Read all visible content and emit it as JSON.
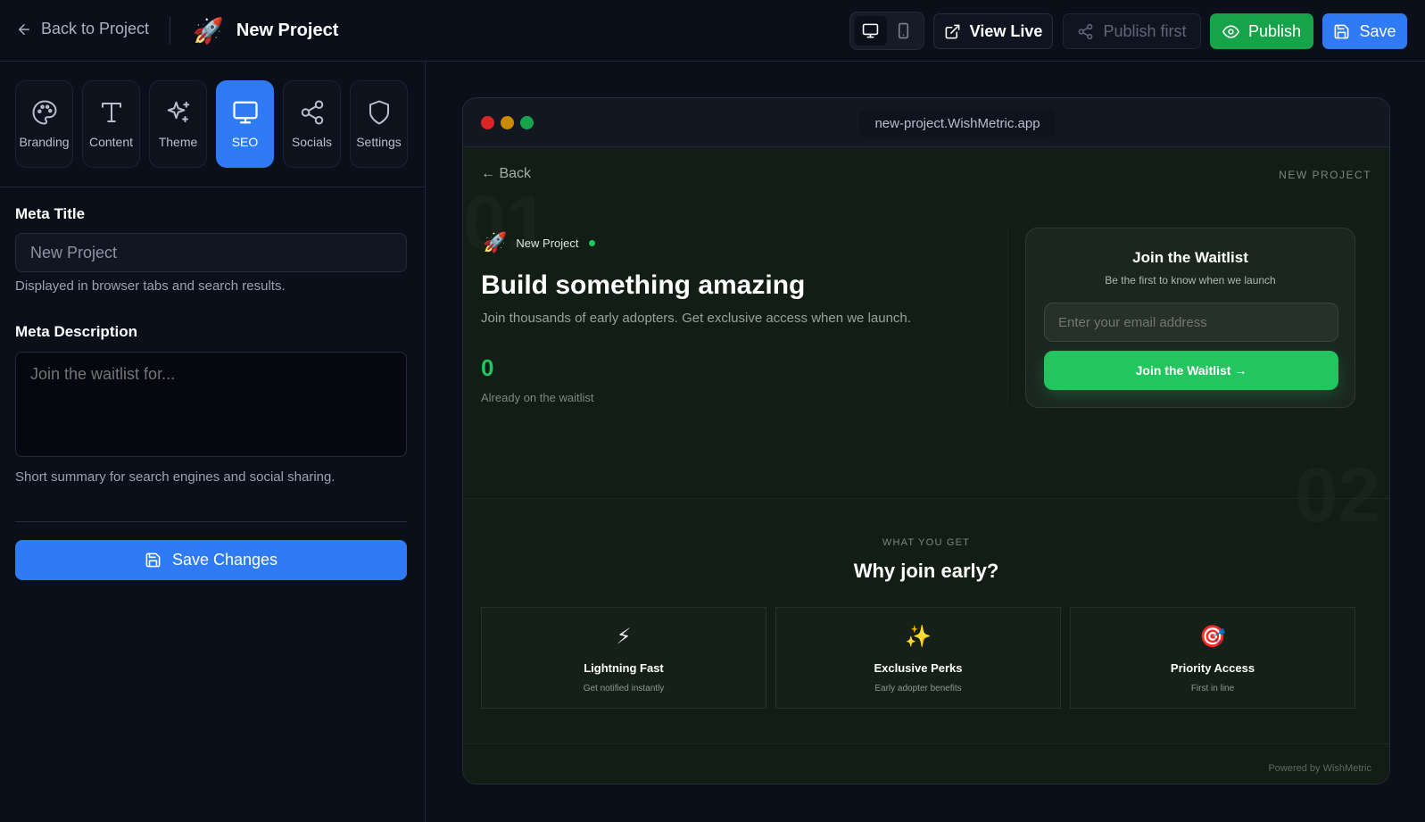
{
  "topbar": {
    "back_label": "Back to Project",
    "project_title": "New Project",
    "project_emoji": "🚀",
    "view_live": "View Live",
    "publish_first": "Publish first",
    "publish": "Publish",
    "save": "Save"
  },
  "sidebar": {
    "tabs": [
      {
        "label": "Branding",
        "icon": "palette-icon"
      },
      {
        "label": "Content",
        "icon": "type-icon"
      },
      {
        "label": "Theme",
        "icon": "sparkles-icon"
      },
      {
        "label": "SEO",
        "icon": "monitor-icon",
        "active": true
      },
      {
        "label": "Socials",
        "icon": "share-icon"
      },
      {
        "label": "Settings",
        "icon": "shield-icon"
      }
    ],
    "meta_title_label": "Meta Title",
    "meta_title_value": "New Project",
    "meta_title_help": "Displayed in browser tabs and search results.",
    "meta_desc_label": "Meta Description",
    "meta_desc_placeholder": "Join the waitlist for...",
    "meta_desc_help": "Short summary for search engines and social sharing.",
    "save_changes": "Save Changes"
  },
  "preview": {
    "url": "new-project.WishMetric.app",
    "back": "← Back",
    "project_name_caps": "NEW PROJECT",
    "ghost_01": "01",
    "ghost_02": "02",
    "brand_emoji": "🚀",
    "brand_name": "New Project",
    "hero_title": "Build something amazing",
    "hero_sub": "Join thousands of early adopters. Get exclusive access when we launch.",
    "count": "0",
    "count_label": "Already on the waitlist",
    "waitlist": {
      "title": "Join the Waitlist",
      "subtitle": "Be the first to know when we launch",
      "email_placeholder": "Enter your email address",
      "button": "Join the Waitlist →"
    },
    "eyebrow": "WHAT YOU GET",
    "why_title": "Why join early?",
    "features": [
      {
        "emoji": "⚡",
        "title": "Lightning Fast",
        "sub": "Get notified instantly"
      },
      {
        "emoji": "✨",
        "title": "Exclusive Perks",
        "sub": "Early adopter benefits"
      },
      {
        "emoji": "🎯",
        "title": "Priority Access",
        "sub": "First in line"
      }
    ],
    "powered_by": "Powered by WishMetric"
  },
  "colors": {
    "accent_blue": "#2f7bf5",
    "publish_green": "#16a34a",
    "waitlist_green": "#22c55e",
    "background": "#0b0f1a"
  }
}
